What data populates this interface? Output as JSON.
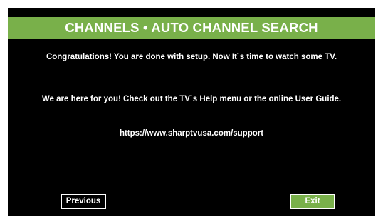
{
  "header": {
    "title": "CHANNELS • AUTO CHANNEL SEARCH"
  },
  "main": {
    "message_1": "Congratulations! You are done with setup. Now It`s time to watch some TV.",
    "message_2": "We are here for you! Check out the TV`s Help menu or the online User Guide.",
    "support_url": "https://www.sharptvusa.com/support"
  },
  "buttons": {
    "previous_label": "Previous",
    "exit_label": "Exit"
  },
  "colors": {
    "accent": "#79b04a",
    "background": "#000000",
    "text": "#ffffff"
  }
}
